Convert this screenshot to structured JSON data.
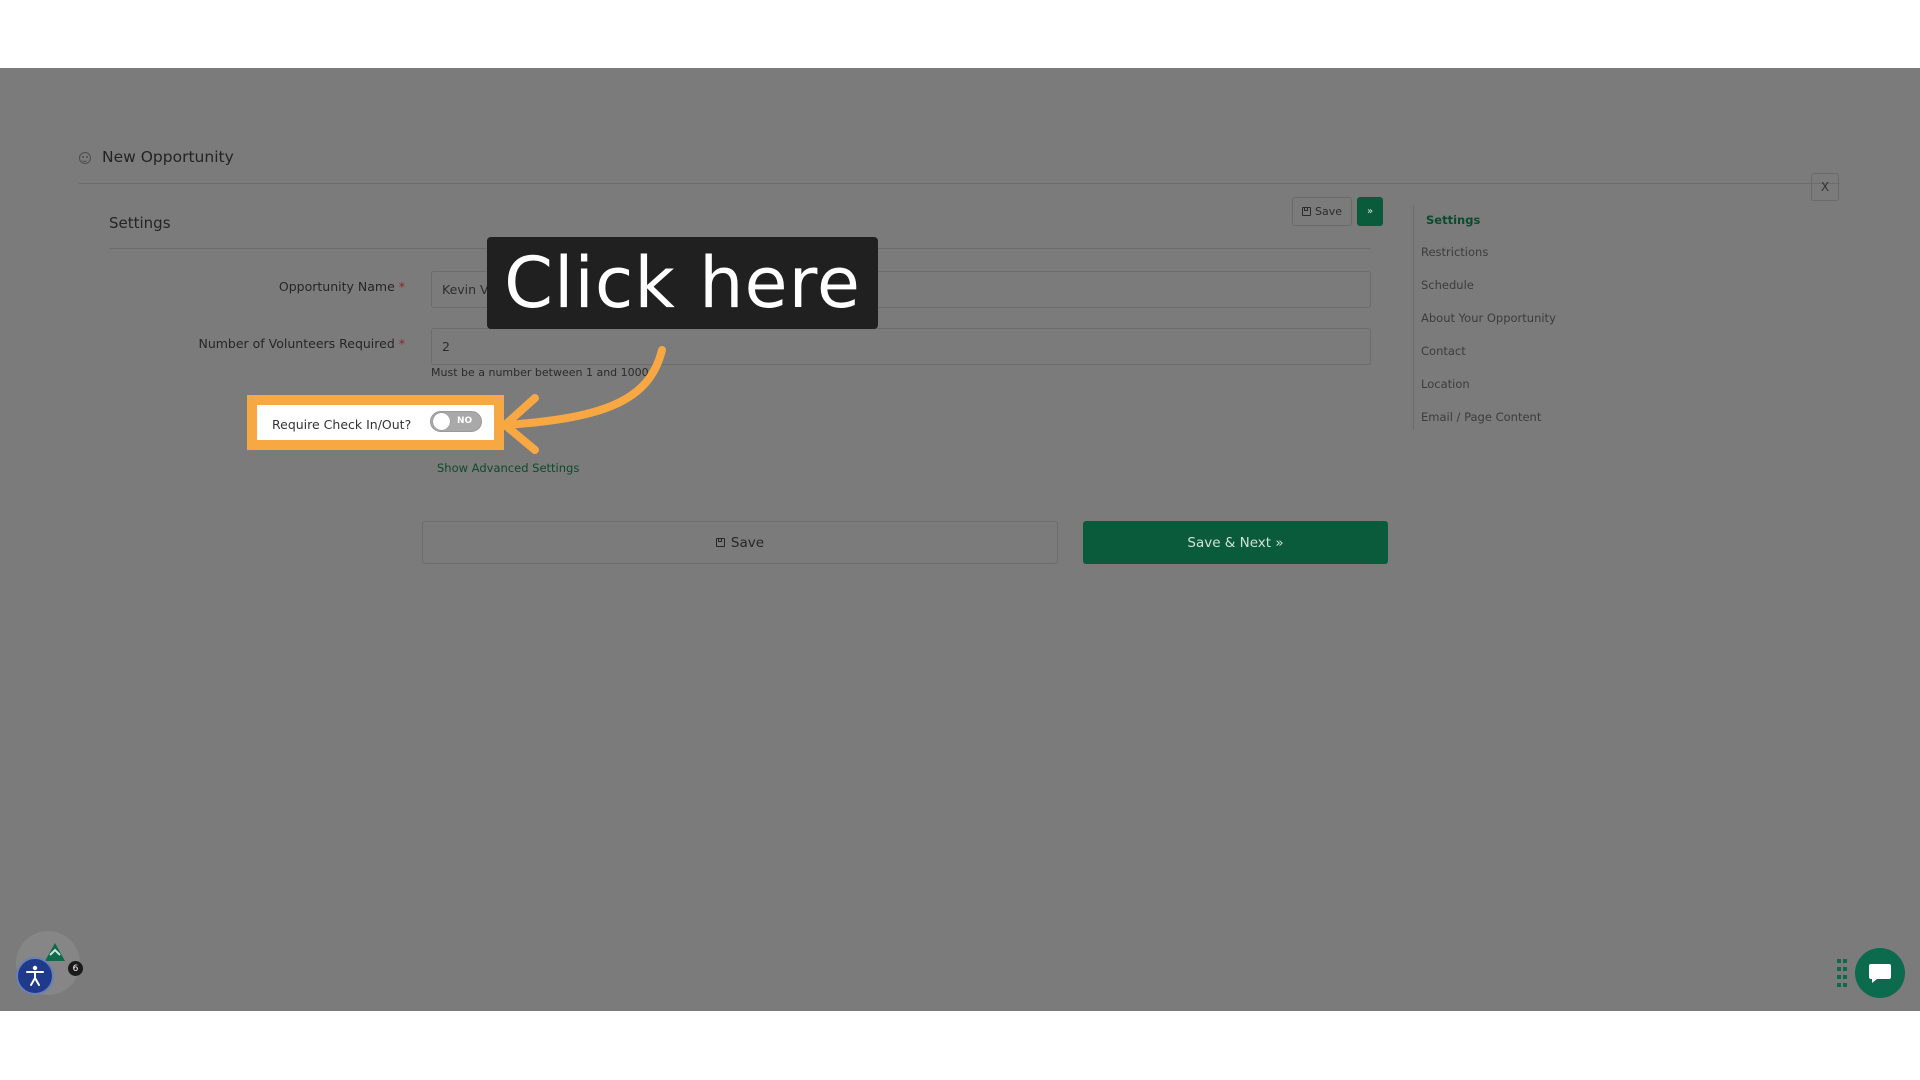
{
  "header": {
    "title": "New Opportunity",
    "close_label": "X"
  },
  "section": {
    "title": "Settings"
  },
  "toolbar": {
    "save_label": "Save",
    "next_label": "»"
  },
  "form": {
    "name_label": "Opportunity Name",
    "name_required": "*",
    "name_value": "Kevin Volunteer Shift",
    "volunteers_label": "Number of Volunteers Required",
    "volunteers_required": "*",
    "volunteers_value": "2",
    "volunteers_help": "Must be a number between 1 and 1000",
    "checkin_label": "Require Check In/Out?",
    "checkin_toggle": "NO",
    "advanced_link": "Show Advanced Settings"
  },
  "actions": {
    "save_label": "Save",
    "save_next_label": "Save & Next »"
  },
  "right_nav": {
    "items": [
      {
        "label": "Settings"
      },
      {
        "label": "Restrictions"
      },
      {
        "label": "Schedule"
      },
      {
        "label": "About Your Opportunity"
      },
      {
        "label": "Contact"
      },
      {
        "label": "Location"
      },
      {
        "label": "Email / Page Content"
      }
    ]
  },
  "callout": {
    "text": "Click here"
  },
  "widgets": {
    "notification_count": "6"
  },
  "colors": {
    "accent": "#0a5a3c",
    "highlight": "#f7a843",
    "overlay": "#7b7b7b"
  }
}
